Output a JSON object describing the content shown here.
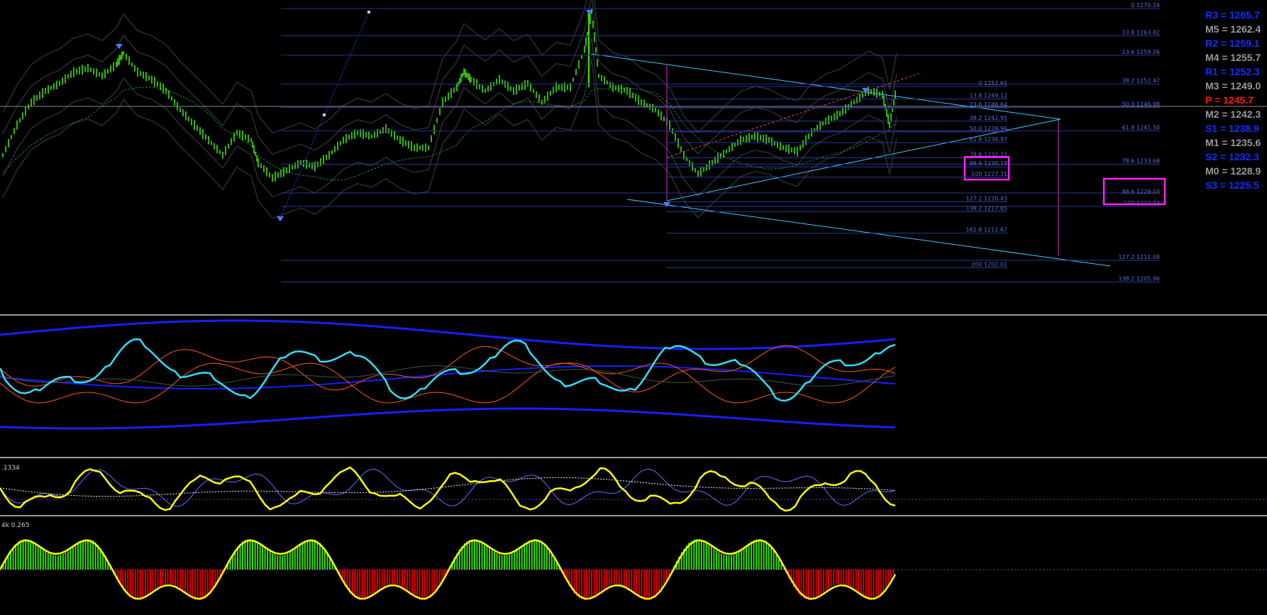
{
  "chart_data": [
    {
      "type": "line",
      "panel": "price",
      "description_free": true,
      "fib_levels_cluster_left": [
        {
          "label": "0 1270.24",
          "value": 1270.24
        },
        {
          "label": "13.8 1263.82",
          "value": 1263.82
        },
        {
          "label": "23.6 1259.26",
          "value": 1259.26
        },
        {
          "label": "38.2 1252.47",
          "value": 1252.47
        },
        {
          "label": "50.0 1246.98",
          "value": 1246.98
        },
        {
          "label": "61.8 1241.50",
          "value": 1241.5
        },
        {
          "label": "78.6 1233.68",
          "value": 1233.68
        },
        {
          "label": "88.6 1229.03",
          "value": 1229.03,
          "boxed": true
        },
        {
          "label": "100 1223.73",
          "value": 1223.73
        },
        {
          "label": "127.2 1211.08",
          "value": 1211.08
        },
        {
          "label": "138.2 1205.96",
          "value": 1205.96
        }
      ],
      "fib_levels_cluster_right": [
        {
          "label": "0 1252.61",
          "value": 1252.61
        },
        {
          "label": "13.8 1249.12",
          "value": 1249.12
        },
        {
          "label": "23.6 1246.64",
          "value": 1246.64
        },
        {
          "label": "38.2 1242.95",
          "value": 1242.95
        },
        {
          "label": "50.0 1239.96",
          "value": 1239.96
        },
        {
          "label": "61.8 1236.97",
          "value": 1236.97
        },
        {
          "label": "78.6 1232.72",
          "value": 1232.72
        },
        {
          "label": "88.6 1230.19",
          "value": 1230.19,
          "boxed": true
        },
        {
          "label": "100 1227.31",
          "value": 1227.31
        },
        {
          "label": "127.2 1220.43",
          "value": 1220.43
        },
        {
          "label": "138.2 1217.65",
          "value": 1217.65
        },
        {
          "label": "161.8 1211.67",
          "value": 1211.67
        },
        {
          "label": "200 1202.01",
          "value": 1202.01
        }
      ],
      "pivots": [
        {
          "label": "R3",
          "text": "R3 = 1265.7",
          "value": 1265.7,
          "color": "#1030ff"
        },
        {
          "label": "M5",
          "text": "M5 = 1262.4",
          "value": 1262.4,
          "color": "#9a9a9a"
        },
        {
          "label": "R2",
          "text": "R2 = 1259.1",
          "value": 1259.1,
          "color": "#1030ff"
        },
        {
          "label": "M4",
          "text": "M4 = 1255.7",
          "value": 1255.7,
          "color": "#9a9a9a"
        },
        {
          "label": "R1",
          "text": "R1 = 1252.3",
          "value": 1252.3,
          "color": "#1030ff"
        },
        {
          "label": "M3",
          "text": "M3 = 1249.0",
          "value": 1249.0,
          "color": "#9a9a9a"
        },
        {
          "label": "P",
          "text": "P  = 1245.7",
          "value": 1245.7,
          "color": "#ff1a1a"
        },
        {
          "label": "M2",
          "text": "M2 = 1242.3",
          "value": 1242.3,
          "color": "#9a9a9a"
        },
        {
          "label": "S1",
          "text": "S1 = 1238.9",
          "value": 1238.9,
          "color": "#1030ff"
        },
        {
          "label": "M1",
          "text": "M1 = 1235.6",
          "value": 1235.6,
          "color": "#9a9a9a"
        },
        {
          "label": "S2",
          "text": "S2 = 1232.3",
          "value": 1232.3,
          "color": "#1030ff"
        },
        {
          "label": "M0",
          "text": "M0 = 1228.9",
          "value": 1228.9,
          "color": "#9a9a9a"
        },
        {
          "label": "S3",
          "text": "S3 = 1225.5",
          "value": 1225.5,
          "color": "#1030ff"
        }
      ],
      "price_series": {
        "name": "",
        "x": [
          0,
          20,
          40,
          60,
          80,
          100,
          120,
          140,
          160,
          170,
          190,
          210,
          230,
          250,
          270,
          290,
          310,
          330,
          350,
          360,
          380,
          400,
          420,
          440,
          460,
          480,
          500,
          520,
          540,
          560,
          580,
          600,
          620,
          640,
          650,
          660,
          680,
          700,
          720,
          740,
          760,
          780,
          800,
          820,
          830,
          840,
          860,
          880,
          900,
          920,
          940,
          960,
          980,
          1000,
          1020,
          1040,
          1060,
          1080,
          1100,
          1120,
          1140,
          1160,
          1180,
          1200,
          1220,
          1240,
          1250,
          1260
        ],
        "y": [
          1232,
          1240,
          1246,
          1249,
          1251,
          1254,
          1255,
          1253,
          1256,
          1259,
          1254,
          1252,
          1249,
          1244,
          1240,
          1236,
          1232,
          1238,
          1236,
          1230,
          1226,
          1228,
          1230,
          1229,
          1232,
          1236,
          1238,
          1237,
          1239,
          1236,
          1234,
          1234,
          1246,
          1250,
          1254,
          1252,
          1249,
          1252,
          1249,
          1251,
          1246,
          1250,
          1250,
          1260,
          1270,
          1253,
          1250,
          1249,
          1246,
          1244,
          1240,
          1232,
          1227,
          1230,
          1233,
          1236,
          1237,
          1236,
          1234,
          1233,
          1238,
          1241,
          1243,
          1246,
          1249,
          1248,
          1240,
          1250
        ]
      }
    },
    {
      "type": "line",
      "panel": "indicator-1",
      "series": [
        {
          "name": "",
          "color": "#30e0ff"
        },
        {
          "name": "",
          "color": "#1520ff"
        },
        {
          "name": "",
          "color": "#ff5a1a"
        }
      ]
    },
    {
      "type": "line",
      "panel": "indicator-2",
      "label": ".1334",
      "series": [
        {
          "name": "",
          "color": "#ffff00"
        },
        {
          "name": "",
          "color": "#6a6aff"
        },
        {
          "name": "",
          "color": "#ffffff"
        }
      ]
    },
    {
      "type": "bar",
      "panel": "indicator-3",
      "label": "4k 0.265",
      "colors": {
        "positive": "#36e000",
        "negative": "#e00000",
        "line": "#ffff00"
      }
    }
  ]
}
